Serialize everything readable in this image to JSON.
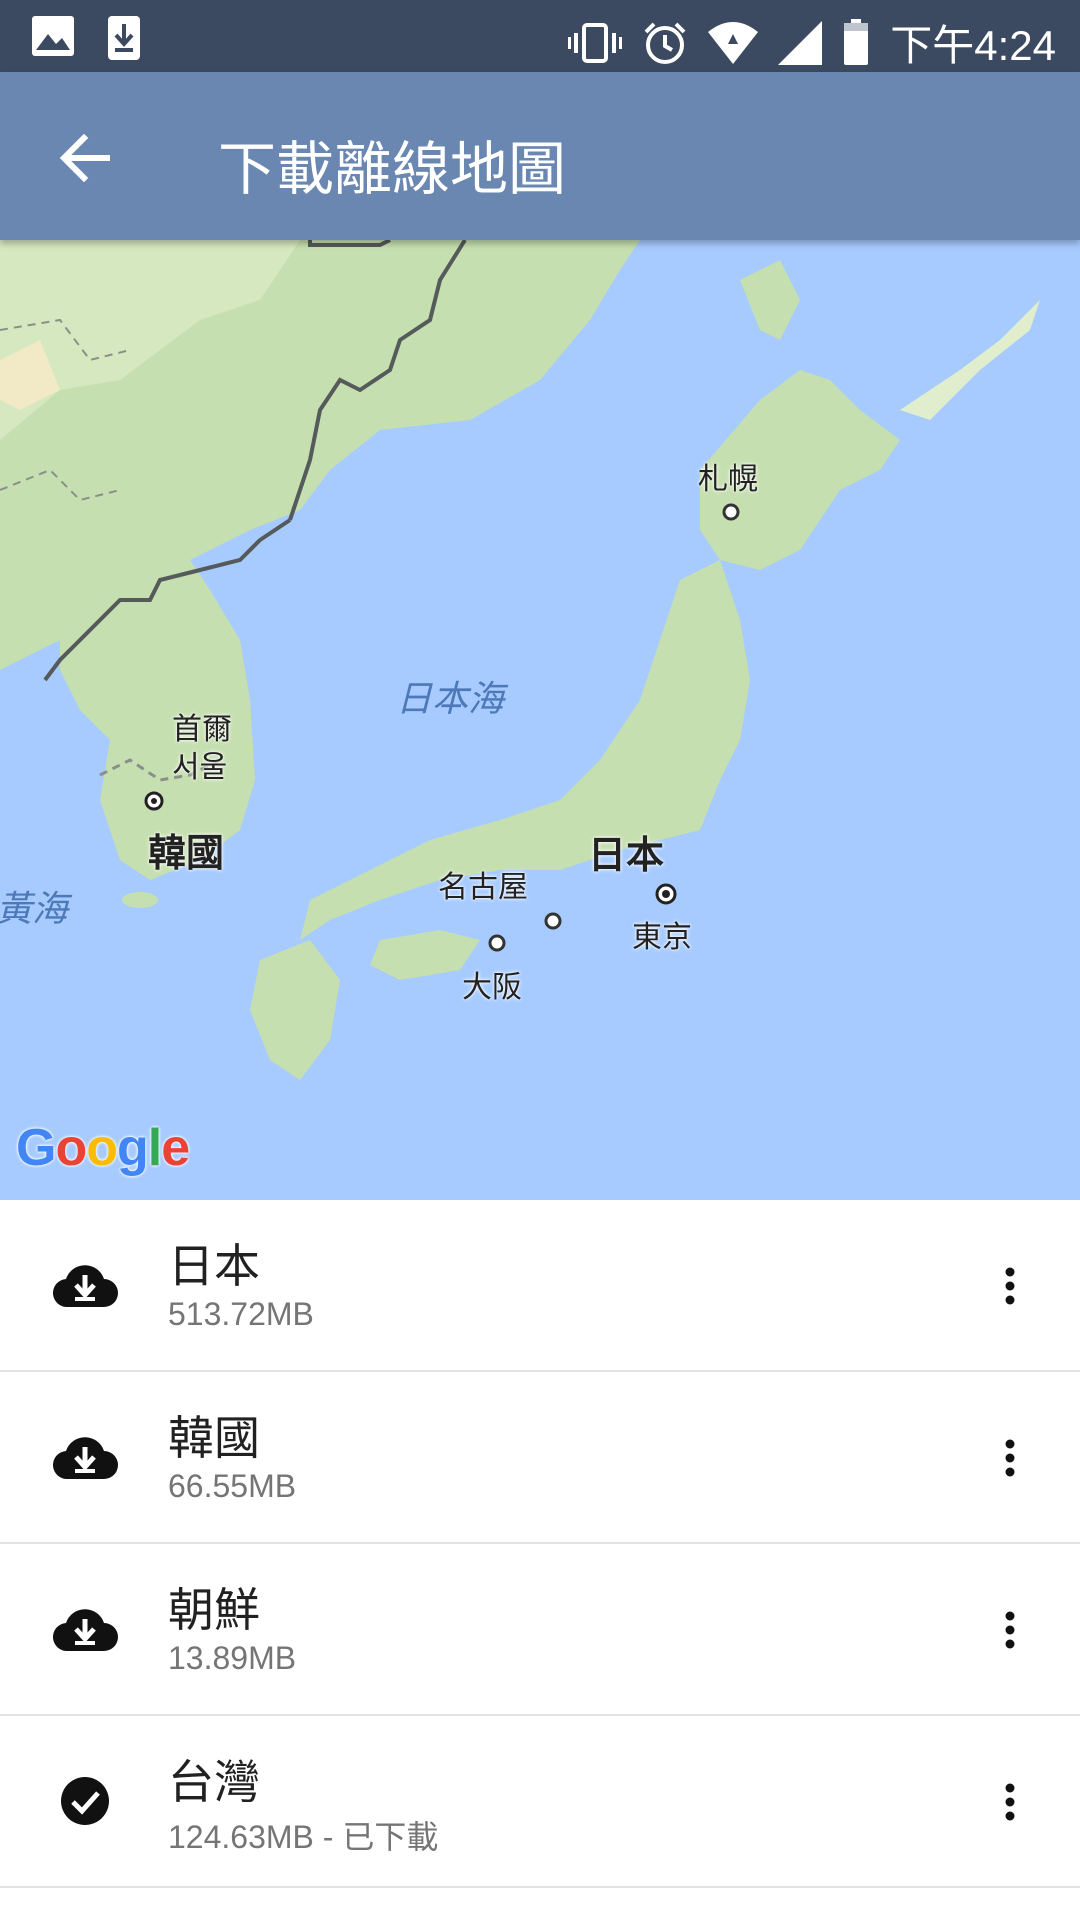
{
  "status_bar": {
    "time": "下午4:24",
    "icons": [
      "image-icon",
      "download-icon",
      "vibrate-icon",
      "alarm-icon",
      "wifi-icon",
      "signal-icon",
      "battery-icon"
    ]
  },
  "app_bar": {
    "title": "下載離線地圖",
    "back_icon": "arrow-back-icon"
  },
  "map": {
    "labels": {
      "sapporo": "札幌",
      "sea_of_japan": "日本海",
      "seoul_zh": "首爾",
      "seoul_ko": "서울",
      "korea": "韓國",
      "japan": "日本",
      "nagoya": "名古屋",
      "tokyo": "東京",
      "osaka": "大阪",
      "yellow_sea": "黃海"
    },
    "attribution": {
      "letters": [
        "G",
        "o",
        "o",
        "g",
        "l",
        "e"
      ],
      "colors": [
        "#4285f4",
        "#ea4335",
        "#fbbc05",
        "#4285f4",
        "#34a853",
        "#ea4335"
      ]
    },
    "colors": {
      "water": "#a7cbff",
      "land": "#c6dfb0",
      "land_dark": "#b2d39d",
      "border": "#555a5a"
    }
  },
  "regions": [
    {
      "name": "日本",
      "size": "513.72MB",
      "status": "",
      "icon": "cloud-download-icon"
    },
    {
      "name": "韓國",
      "size": "66.55MB",
      "status": "",
      "icon": "cloud-download-icon"
    },
    {
      "name": "朝鮮",
      "size": "13.89MB",
      "status": "",
      "icon": "cloud-download-icon"
    },
    {
      "name": "台灣",
      "size": "124.63MB",
      "status": " - 已下載",
      "icon": "check-circle-icon"
    }
  ]
}
